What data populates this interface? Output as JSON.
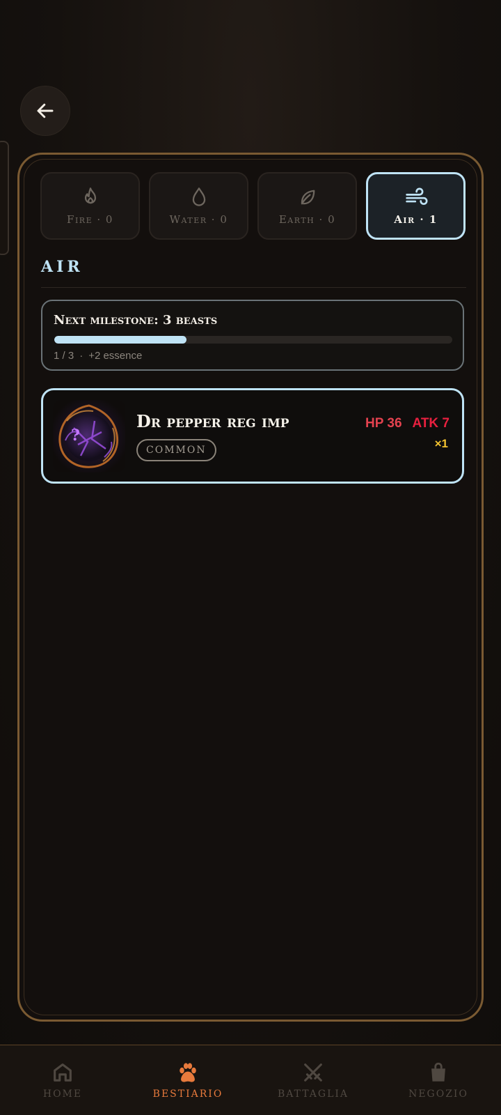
{
  "header": {
    "back_icon": "arrow-left-icon"
  },
  "tabs": [
    {
      "label": "Fire · 0",
      "icon": "flame-icon",
      "active": false
    },
    {
      "label": "Water · 0",
      "icon": "droplet-icon",
      "active": false
    },
    {
      "label": "Earth · 0",
      "icon": "leaf-icon",
      "active": false
    },
    {
      "label": "Air · 1",
      "icon": "wind-icon",
      "active": true
    }
  ],
  "section": {
    "title": "AIR"
  },
  "milestone": {
    "title": "Next milestone: 3 beasts",
    "progress": "1 / 3",
    "progress_fraction": 0.333,
    "reward": "+2 essence"
  },
  "beasts": [
    {
      "name": "Dr pepper reg imp",
      "rarity": "COMMON",
      "hp": "HP 36",
      "atk": "ATK 7",
      "count": "×1"
    }
  ],
  "nav": [
    {
      "label": "HOME",
      "icon": "home-icon",
      "active": false
    },
    {
      "label": "BESTIARIO",
      "icon": "paw-icon",
      "active": true
    },
    {
      "label": "BATTAGLIA",
      "icon": "crossed-swords-icon",
      "active": false
    },
    {
      "label": "NEGOZIO",
      "icon": "shopping-bag-icon",
      "active": false
    }
  ],
  "colors": {
    "accent_air": "#bfe3f5",
    "panel_border": "#7a5a32",
    "nav_active": "#e87a3c",
    "hp": "#e3424f",
    "atk": "#e8203f",
    "count": "#f2c230"
  }
}
